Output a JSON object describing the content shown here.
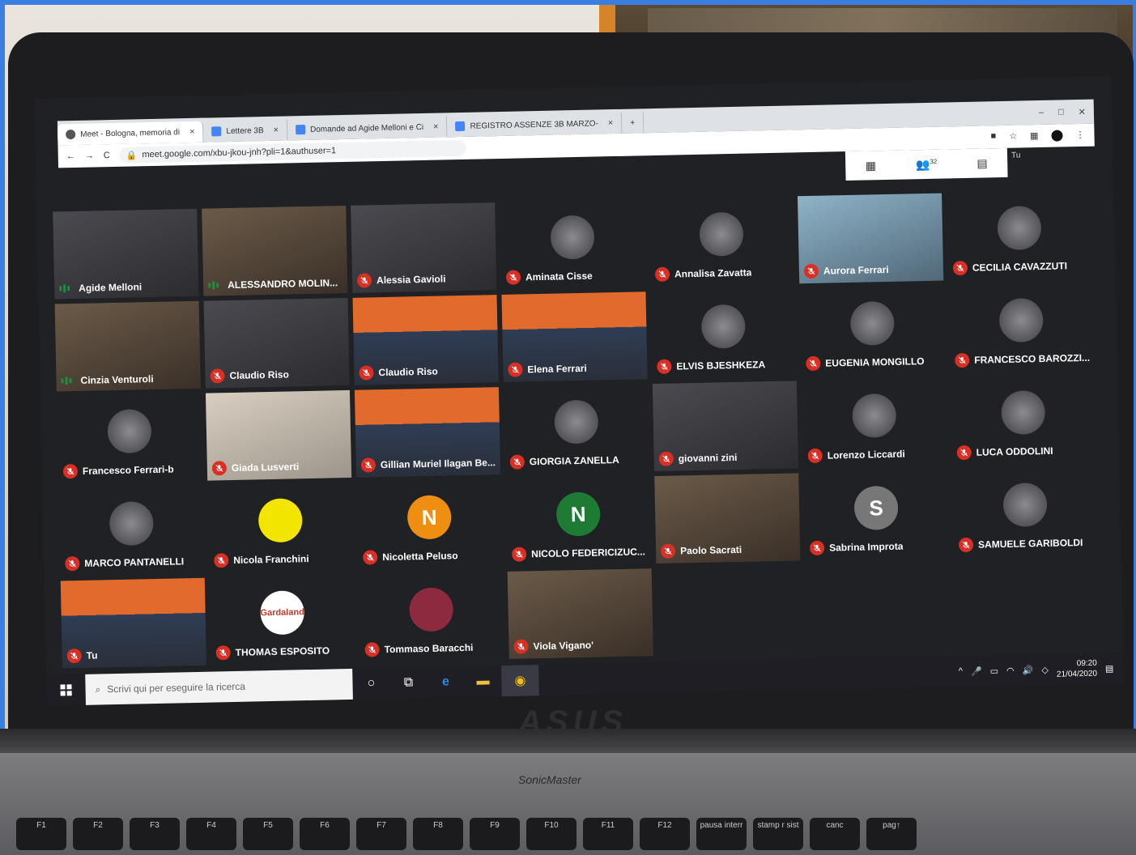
{
  "browser": {
    "tabs": [
      {
        "label": "Meet - Bologna, memoria di",
        "active": true
      },
      {
        "label": "Lettere 3B"
      },
      {
        "label": "Domande ad Agide Melloni e Ci"
      },
      {
        "label": "REGISTRO ASSENZE 3B MARZO-"
      }
    ],
    "new_tab": "+",
    "url": "meet.google.com/xbu-jkou-jnh?pli=1&authuser=1",
    "participants_count": "32"
  },
  "meet": {
    "self_label": "Tu",
    "participants": [
      {
        "name": "Agide Melloni",
        "state": "speaking",
        "kind": "video"
      },
      {
        "name": "ALESSANDRO MOLIN...",
        "state": "speaking",
        "kind": "video"
      },
      {
        "name": "Alessia Gavioli",
        "state": "muted",
        "kind": "video"
      },
      {
        "name": "Aminata Cisse",
        "state": "muted",
        "kind": "avatar"
      },
      {
        "name": "Annalisa Zavatta",
        "state": "muted",
        "kind": "avatar"
      },
      {
        "name": "Aurora Ferrari",
        "state": "muted",
        "kind": "video"
      },
      {
        "name": "CECILIA CAVAZZUTI",
        "state": "muted",
        "kind": "avatar"
      },
      {
        "name": "Cinzia Venturoli",
        "state": "speaking",
        "kind": "video"
      },
      {
        "name": "Claudio Riso",
        "state": "muted",
        "kind": "video"
      },
      {
        "name": "Claudio Riso",
        "state": "muted",
        "kind": "video"
      },
      {
        "name": "Elena Ferrari",
        "state": "muted",
        "kind": "video"
      },
      {
        "name": "ELVIS BJESHKEZA",
        "state": "muted",
        "kind": "avatar"
      },
      {
        "name": "EUGENIA MONGILLO",
        "state": "muted",
        "kind": "avatar"
      },
      {
        "name": "FRANCESCO BAROZZI...",
        "state": "muted",
        "kind": "avatar"
      },
      {
        "name": "Francesco Ferrari-b",
        "state": "muted",
        "kind": "avatar"
      },
      {
        "name": "Giada Lusverti",
        "state": "muted",
        "kind": "video"
      },
      {
        "name": "Gillian Muriel Ilagan Be...",
        "state": "muted",
        "kind": "video"
      },
      {
        "name": "GIORGIA ZANELLA",
        "state": "muted",
        "kind": "avatar"
      },
      {
        "name": "giovanni zini",
        "state": "muted",
        "kind": "video"
      },
      {
        "name": "Lorenzo Liccardi",
        "state": "muted",
        "kind": "avatar"
      },
      {
        "name": "LUCA ODDOLINI",
        "state": "muted",
        "kind": "avatar"
      },
      {
        "name": "MARCO PANTANELLI",
        "state": "muted",
        "kind": "avatar"
      },
      {
        "name": "Nicola Franchini",
        "state": "muted",
        "kind": "avatar",
        "color": "#f2e600"
      },
      {
        "name": "Nicoletta Peluso",
        "state": "muted",
        "kind": "letter",
        "letter": "N",
        "color": "#ef8f12"
      },
      {
        "name": "NICOLO FEDERICIZUC...",
        "state": "muted",
        "kind": "letter",
        "letter": "N",
        "color": "#1e7b34"
      },
      {
        "name": "Paolo Sacrati",
        "state": "muted",
        "kind": "video"
      },
      {
        "name": "Sabrina Improta",
        "state": "muted",
        "kind": "letter",
        "letter": "S",
        "color": "#777"
      },
      {
        "name": "SAMUELE GARIBOLDI",
        "state": "muted",
        "kind": "avatar"
      },
      {
        "name": "Tu",
        "state": "muted",
        "kind": "video"
      },
      {
        "name": "THOMAS ESPOSITO",
        "state": "muted",
        "kind": "avatar",
        "logo_text": "Gardaland"
      },
      {
        "name": "Tommaso Baracchi",
        "state": "muted",
        "kind": "avatar",
        "color": "#8d2a40"
      },
      {
        "name": "Viola Vigano'",
        "state": "muted",
        "kind": "video"
      }
    ]
  },
  "taskbar": {
    "search_placeholder": "Scrivi qui per eseguire la ricerca",
    "time": "09:20",
    "date": "21/04/2020"
  },
  "laptop": {
    "brand": "ASUS",
    "speaker_label": "SonicMaster",
    "keys": [
      "F1",
      "F2",
      "F3",
      "F4",
      "F5",
      "F6",
      "F7",
      "F8",
      "F9",
      "F10",
      "F11",
      "F12",
      "pausa interr",
      "stamp r sist",
      "canc",
      "pag↑"
    ]
  },
  "colors": {
    "muted": "#d93025",
    "speaking": "#1e8e3e",
    "meet_bg": "#202124"
  }
}
